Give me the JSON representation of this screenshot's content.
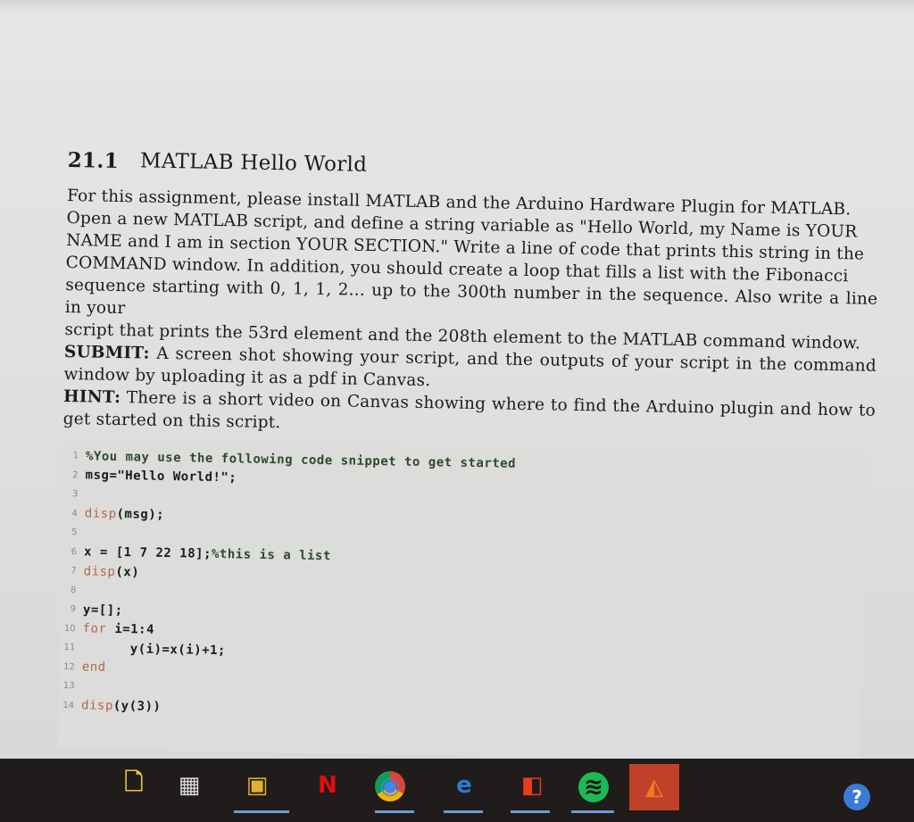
{
  "document": {
    "section_number": "21.1",
    "section_title": "MATLAB Hello World",
    "paragraph_lines": [
      "For this assignment, please install MATLAB and the Arduino Hardware Plugin for MATLAB.",
      "Open a new MATLAB script, and define a string variable as \"Hello World, my Name is YOUR",
      "NAME and I am in section YOUR SECTION.\" Write a line of code that prints this string in the",
      "COMMAND window. In addition, you should create a loop that fills a list with the Fibonacci",
      "sequence starting with 0, 1, 1, 2... up to the 300th number in the sequence. Also write a line in your",
      "script that prints the 53rd element and the 208th element to the MATLAB command window."
    ],
    "submit_label": "SUBMIT:",
    "submit_text": " A screen shot showing your script, and the outputs of your script in the command window by uploading it as a pdf in Canvas.",
    "hint_label": "HINT:",
    "hint_text": " There is a short video on Canvas showing where to find the Arduino plugin and how to get started on this script."
  },
  "code": {
    "lines": [
      {
        "n": "1",
        "text": "%You may use the following code snippet to get started",
        "kind": "comment"
      },
      {
        "n": "2",
        "text": "msg=\"Hello World!\";",
        "kind": "code"
      },
      {
        "n": "3",
        "text": "",
        "kind": "code"
      },
      {
        "n": "4",
        "text": "disp(msg);",
        "kind": "code"
      },
      {
        "n": "5",
        "text": "",
        "kind": "code"
      },
      {
        "n": "6",
        "text": "x = [1 7 22 18];%this is a list",
        "kind": "code"
      },
      {
        "n": "7",
        "text": "disp(x)",
        "kind": "code"
      },
      {
        "n": "8",
        "text": "",
        "kind": "code"
      },
      {
        "n": "9",
        "text": "y=[];",
        "kind": "code"
      },
      {
        "n": "10",
        "text": "for i=1:4",
        "kind": "code"
      },
      {
        "n": "11",
        "text": "      y(i)=x(i)+1;",
        "kind": "code"
      },
      {
        "n": "12",
        "text": "end",
        "kind": "code"
      },
      {
        "n": "13",
        "text": "",
        "kind": "code"
      },
      {
        "n": "14",
        "text": "disp(y(3))",
        "kind": "code"
      }
    ]
  },
  "taskbar": {
    "icons": [
      {
        "name": "file-explorer-icon",
        "glyph": "🗋",
        "color": "#e8c24a"
      },
      {
        "name": "task-view-icon",
        "glyph": "▦",
        "color": "#dddddd"
      },
      {
        "name": "save-file-icon",
        "glyph": "▣",
        "color": "#e0b030"
      },
      {
        "name": "netflix-icon",
        "glyph": "N",
        "color": "#e50914"
      },
      {
        "name": "chrome-icon",
        "glyph": "◉",
        "color": "#3aa757"
      },
      {
        "name": "edge-icon",
        "glyph": "e",
        "color": "#2b7cd3"
      },
      {
        "name": "office-icon",
        "glyph": "◧",
        "color": "#e43e1c"
      },
      {
        "name": "spotify-icon",
        "glyph": "≋",
        "color": "#1db954"
      },
      {
        "name": "matlab-icon",
        "glyph": "◭",
        "color": "#f07b1e"
      },
      {
        "name": "help-icon",
        "glyph": "?",
        "color": "#3b7bd6"
      }
    ]
  }
}
